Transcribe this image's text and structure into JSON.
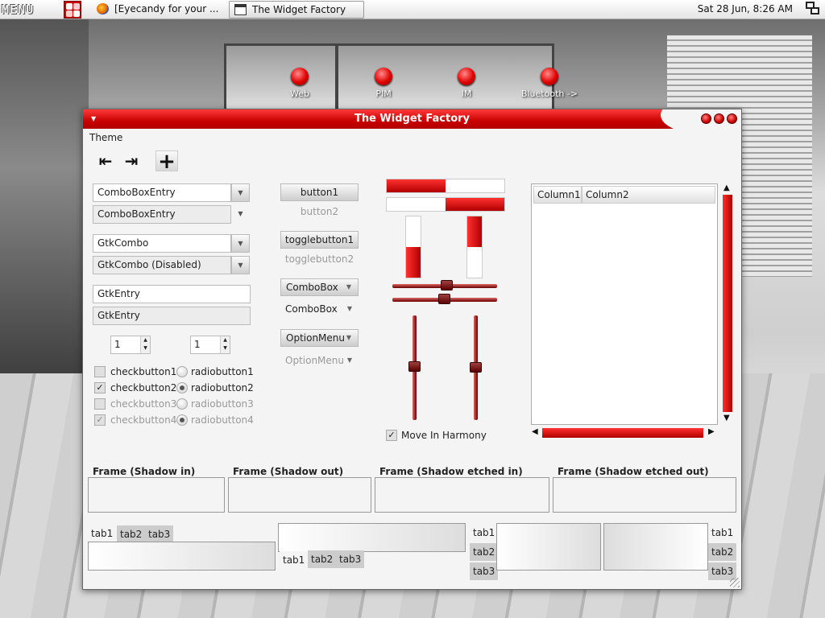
{
  "panel": {
    "menu_label": "MENU",
    "tasks": [
      {
        "title": "[Eyecandy for your ...",
        "icon": "firefox-icon"
      },
      {
        "title": "The Widget Factory",
        "icon": "window-icon"
      }
    ],
    "clock": "Sat 28 Jun,  8:26 AM"
  },
  "launchers": [
    "Web",
    "PIM",
    "IM",
    "Bluetooth ->"
  ],
  "window": {
    "title": "The Widget Factory",
    "accent": "#cc0000",
    "menu": [
      "Theme"
    ],
    "toolbar": [
      "go-first-icon",
      "go-last-icon",
      "add-icon"
    ]
  },
  "left": {
    "combo_entry_1": "ComboBoxEntry",
    "combo_entry_2": "ComboBoxEntry",
    "gtk_combo": "GtkCombo",
    "gtk_combo_disabled": "GtkCombo (Disabled)",
    "entry_1": "GtkEntry",
    "entry_2": "GtkEntry",
    "spin_1": "1",
    "spin_2": "1",
    "checks": [
      {
        "label": "checkbutton1",
        "checked": false,
        "disabled": false
      },
      {
        "label": "checkbutton2",
        "checked": true,
        "disabled": false
      },
      {
        "label": "checkbutton3",
        "checked": false,
        "disabled": true
      },
      {
        "label": "checkbutton4",
        "checked": true,
        "disabled": true
      }
    ],
    "radios": [
      {
        "label": "radiobutton1",
        "selected": false,
        "disabled": false
      },
      {
        "label": "radiobutton2",
        "selected": true,
        "disabled": false
      },
      {
        "label": "radiobutton3",
        "selected": false,
        "disabled": true
      },
      {
        "label": "radiobutton4",
        "selected": true,
        "disabled": true
      }
    ]
  },
  "buttons": {
    "button1": "button1",
    "button2": "button2",
    "toggle1": "togglebutton1",
    "toggle2": "togglebutton2",
    "combo1": "ComboBox",
    "combo2": "ComboBox",
    "option1": "OptionMenu",
    "option2": "OptionMenu"
  },
  "progress": {
    "horizontal": [
      0.5,
      0.5
    ],
    "vertical": [
      0.5,
      0.5
    ]
  },
  "harmony_label": "Move In Harmony",
  "tree": {
    "columns": [
      "Column1",
      "Column2"
    ]
  },
  "frames": [
    "Frame (Shadow in)",
    "Frame (Shadow out)",
    "Frame (Shadow etched in)",
    "Frame (Shadow etched out)"
  ],
  "tabs": [
    "tab1",
    "tab2",
    "tab3"
  ]
}
